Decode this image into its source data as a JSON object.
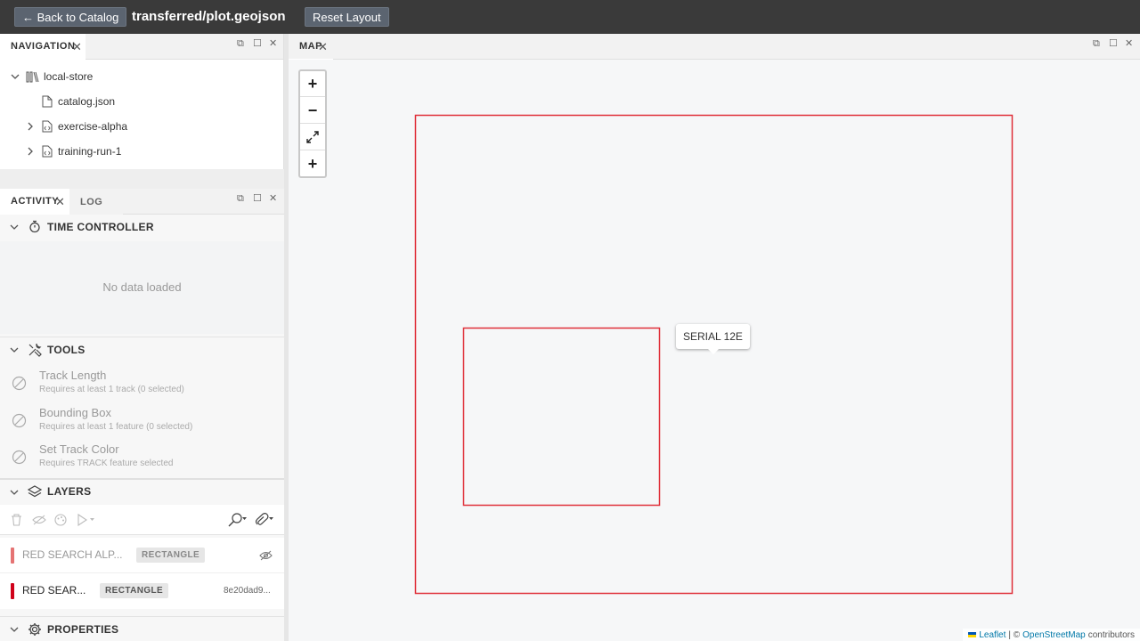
{
  "topbar": {
    "back_label": "← Back to Catalog",
    "file_title": "transferred/plot.geojson",
    "reset_label": "Reset Layout"
  },
  "navigation": {
    "tab_label": "NAVIGATION",
    "tree": [
      {
        "label": "local-store",
        "icon": "library-icon",
        "expanded": true
      },
      {
        "label": "catalog.json",
        "icon": "file-icon"
      },
      {
        "label": "exercise-alpha",
        "icon": "code-file-icon",
        "expanded": false
      },
      {
        "label": "training-run-1",
        "icon": "code-file-icon",
        "expanded": false
      }
    ]
  },
  "activity": {
    "tabs": [
      "ACTIVITY",
      "LOG"
    ],
    "time_controller": {
      "title": "TIME CONTROLLER",
      "empty_text": "No data loaded"
    },
    "tools": {
      "title": "TOOLS",
      "items": [
        {
          "name": "Track Length",
          "requirement": "Requires at least 1 track (0 selected)"
        },
        {
          "name": "Bounding Box",
          "requirement": "Requires at least 1 feature (0 selected)"
        },
        {
          "name": "Set Track Color",
          "requirement": "Requires TRACK feature selected"
        }
      ]
    },
    "layers": {
      "title": "LAYERS",
      "items": [
        {
          "name": "RED SEARCH ALP...",
          "type": "RECTANGLE",
          "color": "#e57373",
          "dimmed": true
        },
        {
          "name": "RED SEAR...",
          "type": "RECTANGLE",
          "color": "#d0021b",
          "id": "8e20dad9..."
        }
      ]
    },
    "properties": {
      "title": "PROPERTIES"
    }
  },
  "map": {
    "tab_label": "MAP",
    "zoom_in": "+",
    "zoom_out": "−",
    "extra_add": "+",
    "tooltip": "SERIAL 12E",
    "shape_color": "#e0303a",
    "attribution": {
      "leaflet": "Leaflet",
      "sep": "| ©",
      "osm": "OpenStreetMap",
      "contributors": "contributors"
    }
  },
  "colors": {
    "topbar": "#3a3a3a",
    "button": "#5b6470",
    "accent_red": "#d0021b"
  }
}
